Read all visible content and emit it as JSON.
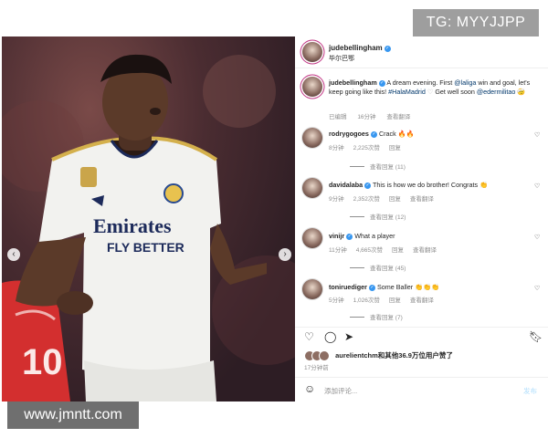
{
  "watermarks": {
    "top": "TG: MYYJJPP",
    "bottom": "www.jmntt.com"
  },
  "photo": {
    "jersey_text_1": "Emirates",
    "jersey_text_2": "FLY BETTER",
    "back_number": "10"
  },
  "post": {
    "author": "judebellingham",
    "subtitle": "毕尔巴鄂",
    "caption_user": "judebellingham",
    "caption_parts": {
      "a": "A dream evening. First ",
      "laliga": "@laliga",
      "b": " win and goal, let's keep going like this! ",
      "hashtag": "#HalaMadrid",
      "c": " Get well soon ",
      "militao": "@edermilitao"
    },
    "caption_emoji": "♡",
    "caption_end_emoji": "🤕",
    "caption_meta": {
      "edited": "已编辑",
      "time": "16分钟",
      "translate": "查看翻译"
    }
  },
  "comments": [
    {
      "user": "rodrygogoes",
      "text": "Crack 🔥🔥",
      "time": "8分钟",
      "likes": "2,225次赞",
      "reply": "回复",
      "translate": "",
      "replies": "查看回复 (11)"
    },
    {
      "user": "davidalaba",
      "text": "This is how we do brother! Congrats 👏",
      "time": "9分钟",
      "likes": "2,352次赞",
      "reply": "回复",
      "translate": "查看翻译",
      "replies": "查看回复 (12)"
    },
    {
      "user": "vinijr",
      "text": "What a player",
      "time": "11分钟",
      "likes": "4,665次赞",
      "reply": "回复",
      "translate": "查看翻译",
      "replies": "查看回复 (45)"
    },
    {
      "user": "toniruediger",
      "text": "Some Baller 👏👏👏",
      "time": "5分钟",
      "likes": "1,026次赞",
      "reply": "回复",
      "translate": "查看翻译",
      "replies": "查看回复 (7)"
    }
  ],
  "likes_line": {
    "user": "aurelientchm",
    "rest": "和其他36.9万位用户赞了"
  },
  "time_ago": "17分钟前",
  "add_comment": {
    "placeholder": "添加评论...",
    "post_button": "发布"
  }
}
